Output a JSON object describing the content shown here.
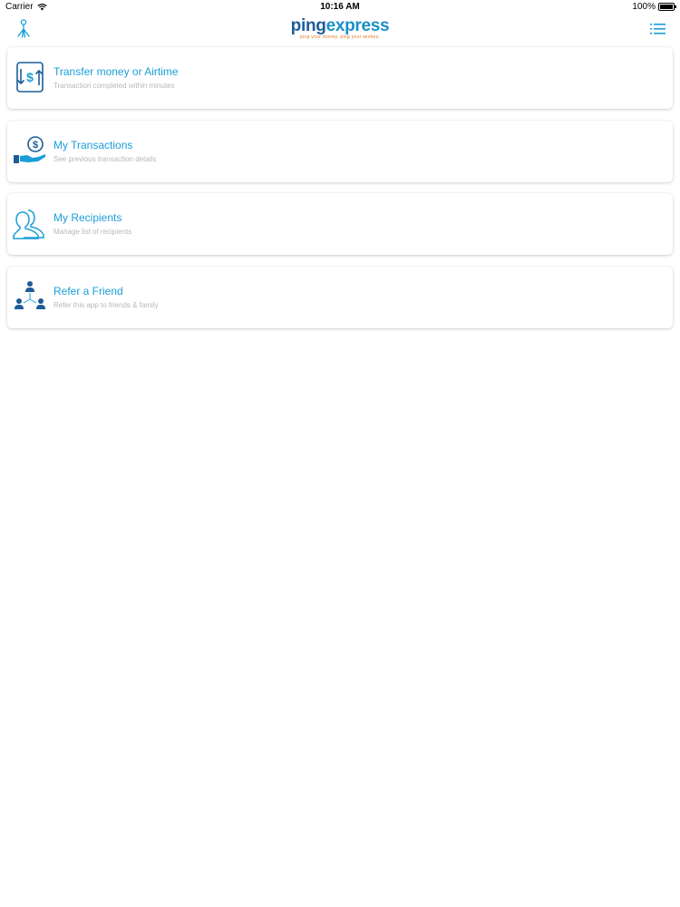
{
  "status_bar": {
    "carrier": "Carrier",
    "time": "10:16 AM",
    "battery": "100%"
  },
  "nav": {
    "logo_ping": "ping",
    "logo_express": "express",
    "logo_tagline": "ping your money. ping your wishes.",
    "left_icon": "profile-icon",
    "right_icon": "menu-list-icon"
  },
  "colors": {
    "accent": "#1a9ed9",
    "icon_dark": "#1c5d98",
    "subtitle": "#b8b8b8"
  },
  "menu": [
    {
      "icon": "transfer-money-icon",
      "title": "Transfer money or Airtime",
      "subtitle": "Transaction completed within minutes"
    },
    {
      "icon": "transactions-icon",
      "title": "My Transactions",
      "subtitle": "See previous transaction details"
    },
    {
      "icon": "recipients-icon",
      "title": "My Recipients",
      "subtitle": "Manage list of recipients"
    },
    {
      "icon": "refer-friend-icon",
      "title": "Refer a Friend",
      "subtitle": "Refer this app to friends & family"
    }
  ]
}
